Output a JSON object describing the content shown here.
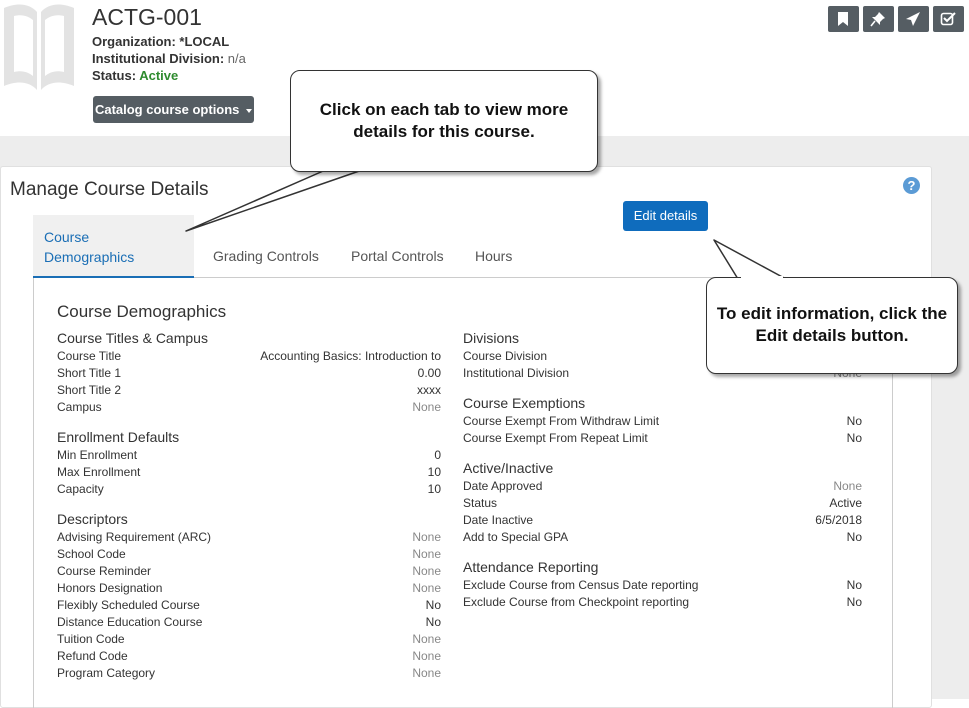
{
  "header": {
    "course_code": "ACTG-001",
    "organization_label": "Organization:",
    "organization_value": "*LOCAL",
    "division_label": "Institutional Division:",
    "division_value": "n/a",
    "status_label": "Status:",
    "status_value": "Active",
    "options_button": "Catalog course options"
  },
  "toolbar": [
    "bookmark-icon",
    "pin-icon",
    "send-icon",
    "check-square-icon"
  ],
  "panel": {
    "title": "Manage Course Details",
    "help": "?",
    "edit_button": "Edit details",
    "tabs": [
      "Course Demographics",
      "Grading Controls",
      "Portal Controls",
      "Hours"
    ],
    "section_title": "Course Demographics"
  },
  "left_groups": [
    {
      "title": "Course Titles & Campus",
      "rows": [
        {
          "label": "Course Title",
          "value": "Accounting Basics: Introduction to"
        },
        {
          "label": "Short Title 1",
          "value": "0.00"
        },
        {
          "label": "Short Title 2",
          "value": "xxxx"
        },
        {
          "label": "Campus",
          "value": "None"
        }
      ]
    },
    {
      "title": "Enrollment Defaults",
      "rows": [
        {
          "label": "Min Enrollment",
          "value": "0"
        },
        {
          "label": "Max Enrollment",
          "value": "10"
        },
        {
          "label": "Capacity",
          "value": "10"
        }
      ]
    },
    {
      "title": "Descriptors",
      "rows": [
        {
          "label": "Advising Requirement (ARC)",
          "value": "None"
        },
        {
          "label": "School Code",
          "value": "None"
        },
        {
          "label": "Course Reminder",
          "value": "None"
        },
        {
          "label": "Honors Designation",
          "value": "None"
        },
        {
          "label": "Flexibly Scheduled Course",
          "value": "No"
        },
        {
          "label": "Distance Education Course",
          "value": "No"
        },
        {
          "label": "Tuition Code",
          "value": "None"
        },
        {
          "label": "Refund Code",
          "value": "None"
        },
        {
          "label": "Program Category",
          "value": "None"
        }
      ]
    }
  ],
  "right_groups": [
    {
      "title": "Divisions",
      "rows": [
        {
          "label": "Course Division",
          "value": ""
        },
        {
          "label": "Institutional Division",
          "value": "None"
        }
      ]
    },
    {
      "title": "Course Exemptions",
      "rows": [
        {
          "label": "Course Exempt From Withdraw Limit",
          "value": "No"
        },
        {
          "label": "Course Exempt From Repeat Limit",
          "value": "No"
        }
      ]
    },
    {
      "title": "Active/Inactive",
      "rows": [
        {
          "label": "Date Approved",
          "value": "None"
        },
        {
          "label": "Status",
          "value": "Active"
        },
        {
          "label": "Date Inactive",
          "value": "6/5/2018"
        },
        {
          "label": "Add to Special GPA",
          "value": "No"
        }
      ]
    },
    {
      "title": "Attendance Reporting",
      "rows": [
        {
          "label": "Exclude Course from Census Date reporting",
          "value": "No"
        },
        {
          "label": "Exclude Course from Checkpoint reporting",
          "value": "No"
        }
      ]
    }
  ],
  "callouts": {
    "tabs_hint": "Click on each tab to view more details for this course.",
    "edit_hint": "To edit information, click the Edit details button."
  }
}
